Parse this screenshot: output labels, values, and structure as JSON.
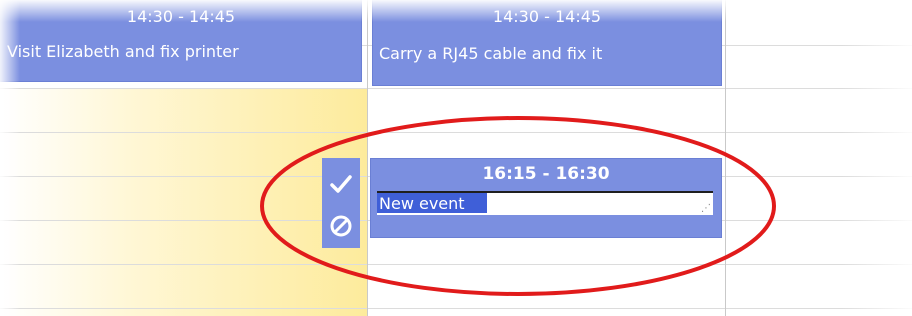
{
  "events": [
    {
      "time": "14:30 - 14:45",
      "title": "Visit Elizabeth and fix printer"
    },
    {
      "time": "14:30 - 14:45",
      "title": "Carry a RJ45 cable and fix it"
    }
  ],
  "editing_event": {
    "time": "16:15 - 16:30",
    "input_value": "New event"
  },
  "actions": {
    "confirm_icon": "checkmark-icon",
    "cancel_icon": "cancel-icon"
  },
  "colors": {
    "event_bg": "#7b8fe0",
    "highlight_col": "#fdeb9c",
    "annotation": "#e11b1b",
    "selection": "#3f5fd8"
  }
}
